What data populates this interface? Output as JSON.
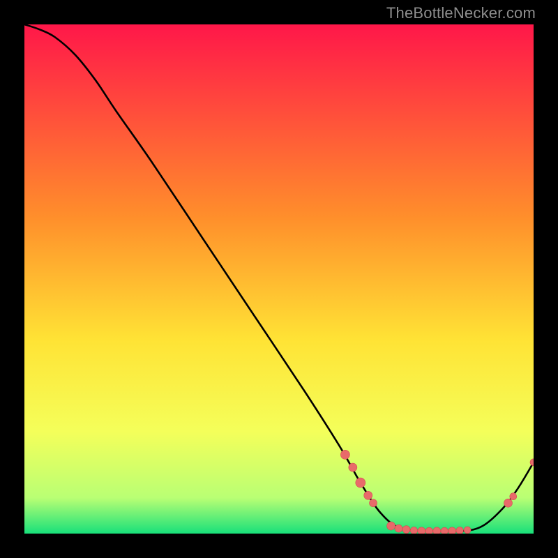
{
  "watermark": "TheBottleNecker.com",
  "colors": {
    "curve": "#000000",
    "marker_fill": "#e86a6a",
    "marker_stroke": "#d34e4e",
    "gradient_top": "#ff1749",
    "gradient_mid_upper": "#ff8f2b",
    "gradient_mid": "#ffe335",
    "gradient_mid_lower": "#f4ff5a",
    "gradient_low": "#b9ff74",
    "gradient_bottom": "#18e07a"
  },
  "chart_data": {
    "type": "line",
    "title": "",
    "xlabel": "",
    "ylabel": "",
    "xlim": [
      0,
      100
    ],
    "ylim": [
      0,
      100
    ],
    "grid": false,
    "legend": false,
    "curve": [
      {
        "x": 0,
        "y": 100
      },
      {
        "x": 3,
        "y": 99
      },
      {
        "x": 6,
        "y": 97.5
      },
      {
        "x": 10,
        "y": 94
      },
      {
        "x": 14,
        "y": 89
      },
      {
        "x": 18,
        "y": 83
      },
      {
        "x": 25,
        "y": 73
      },
      {
        "x": 35,
        "y": 58
      },
      {
        "x": 45,
        "y": 43
      },
      {
        "x": 55,
        "y": 28
      },
      {
        "x": 62,
        "y": 17
      },
      {
        "x": 66,
        "y": 10
      },
      {
        "x": 70,
        "y": 4
      },
      {
        "x": 74,
        "y": 1
      },
      {
        "x": 80,
        "y": 0.5
      },
      {
        "x": 86,
        "y": 0.5
      },
      {
        "x": 90,
        "y": 1.5
      },
      {
        "x": 94,
        "y": 5
      },
      {
        "x": 97,
        "y": 9
      },
      {
        "x": 100,
        "y": 14
      }
    ],
    "markers": [
      {
        "x": 63,
        "y": 15.5,
        "r": 6.5
      },
      {
        "x": 64.5,
        "y": 13,
        "r": 6
      },
      {
        "x": 66,
        "y": 10,
        "r": 7
      },
      {
        "x": 67.5,
        "y": 7.5,
        "r": 6
      },
      {
        "x": 68.5,
        "y": 6,
        "r": 5.5
      },
      {
        "x": 72,
        "y": 1.5,
        "r": 6
      },
      {
        "x": 73.5,
        "y": 1,
        "r": 5.5
      },
      {
        "x": 75,
        "y": 0.8,
        "r": 5.5
      },
      {
        "x": 76.5,
        "y": 0.6,
        "r": 5.2
      },
      {
        "x": 78,
        "y": 0.5,
        "r": 5.5
      },
      {
        "x": 79.5,
        "y": 0.5,
        "r": 5.2
      },
      {
        "x": 81,
        "y": 0.5,
        "r": 5.5
      },
      {
        "x": 82.5,
        "y": 0.5,
        "r": 5.2
      },
      {
        "x": 84,
        "y": 0.5,
        "r": 5.5
      },
      {
        "x": 85.5,
        "y": 0.6,
        "r": 5.2
      },
      {
        "x": 87,
        "y": 0.7,
        "r": 5
      },
      {
        "x": 95,
        "y": 6,
        "r": 6
      },
      {
        "x": 96,
        "y": 7.3,
        "r": 5
      },
      {
        "x": 100,
        "y": 14,
        "r": 5
      }
    ],
    "gradient_stops": [
      {
        "offset": 0.0,
        "color_key": "gradient_top"
      },
      {
        "offset": 0.38,
        "color_key": "gradient_mid_upper"
      },
      {
        "offset": 0.62,
        "color_key": "gradient_mid"
      },
      {
        "offset": 0.8,
        "color_key": "gradient_mid_lower"
      },
      {
        "offset": 0.93,
        "color_key": "gradient_low"
      },
      {
        "offset": 1.0,
        "color_key": "gradient_bottom"
      }
    ]
  }
}
